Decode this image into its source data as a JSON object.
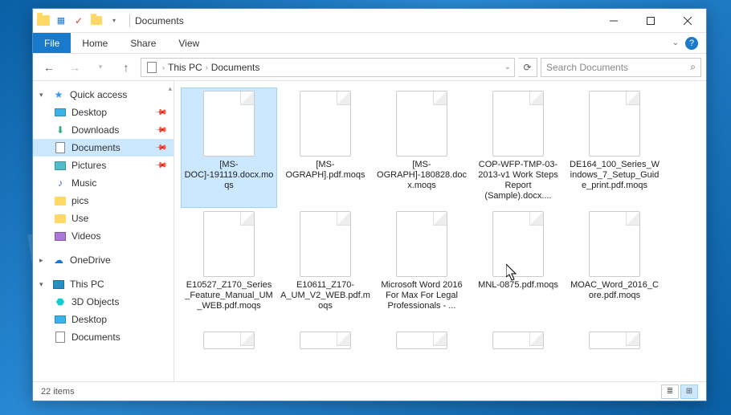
{
  "watermark": "MYANTISPYWARE.COM",
  "window": {
    "title": "Documents"
  },
  "ribbon": {
    "file": "File",
    "tabs": [
      "Home",
      "Share",
      "View"
    ]
  },
  "nav": {
    "back_tip": "Back",
    "forward_tip": "Forward",
    "up_tip": "Up"
  },
  "breadcrumb": {
    "segments": [
      "This PC",
      "Documents"
    ]
  },
  "search": {
    "placeholder": "Search Documents"
  },
  "sidebar": {
    "quick_access": {
      "label": "Quick access",
      "items": [
        {
          "label": "Desktop",
          "pinned": true
        },
        {
          "label": "Downloads",
          "pinned": true
        },
        {
          "label": "Documents",
          "pinned": true,
          "selected": true
        },
        {
          "label": "Pictures",
          "pinned": true
        },
        {
          "label": "Music",
          "pinned": false
        },
        {
          "label": "pics",
          "pinned": false
        },
        {
          "label": "Use",
          "pinned": false
        },
        {
          "label": "Videos",
          "pinned": false
        }
      ]
    },
    "onedrive": {
      "label": "OneDrive"
    },
    "this_pc": {
      "label": "This PC",
      "items": [
        {
          "label": "3D Objects"
        },
        {
          "label": "Desktop"
        },
        {
          "label": "Documents"
        }
      ]
    }
  },
  "files": [
    {
      "name": "[MS-DOC]-191119.docx.moqs",
      "selected": true
    },
    {
      "name": "[MS-OGRAPH].pdf.moqs"
    },
    {
      "name": "[MS-OGRAPH]-180828.docx.moqs"
    },
    {
      "name": "COP-WFP-TMP-03-2013-v1 Work Steps Report (Sample).docx...."
    },
    {
      "name": "DE164_100_Series_Windows_7_Setup_Guide_print.pdf.moqs"
    },
    {
      "name": "E10527_Z170_Series_Feature_Manual_UM_WEB.pdf.moqs"
    },
    {
      "name": "E10611_Z170-A_UM_V2_WEB.pdf.moqs"
    },
    {
      "name": "Microsoft Word 2016 For Max For Legal Professionals - ..."
    },
    {
      "name": "MNL-0875.pdf.moqs"
    },
    {
      "name": "MOAC_Word_2016_Core.pdf.moqs"
    }
  ],
  "status": {
    "item_count": "22 items"
  }
}
